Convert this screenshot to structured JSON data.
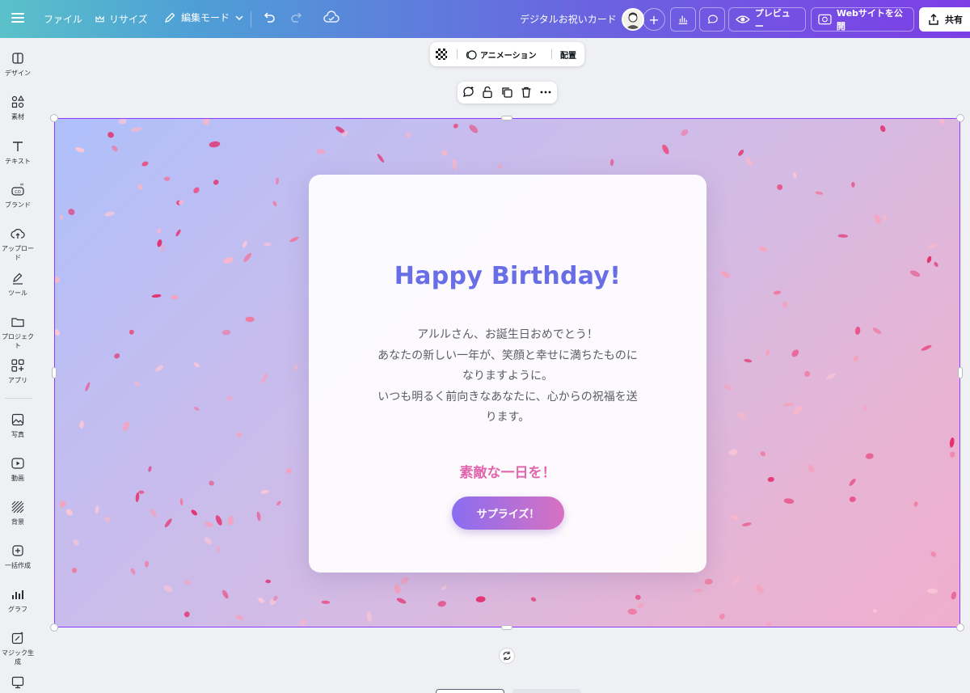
{
  "topbar": {
    "file": "ファイル",
    "resize": "リサイズ",
    "edit_mode": "編集モード",
    "title": "デジタルお祝いカード",
    "preview": "プレビュー",
    "publish": "Webサイトを公開",
    "share": "共有"
  },
  "sidebar": {
    "items": [
      {
        "label": "デザイン",
        "icon": "design-icon"
      },
      {
        "label": "素材",
        "icon": "elements-icon"
      },
      {
        "label": "テキスト",
        "icon": "text-icon"
      },
      {
        "label": "ブランド",
        "icon": "brand-icon"
      },
      {
        "label": "アップロード",
        "icon": "upload-icon"
      },
      {
        "label": "ツール",
        "icon": "tools-icon"
      },
      {
        "label": "プロジェクト",
        "icon": "folder-icon"
      },
      {
        "label": "アプリ",
        "icon": "apps-icon"
      },
      {
        "label": "写真",
        "icon": "photo-icon"
      },
      {
        "label": "動画",
        "icon": "video-icon"
      },
      {
        "label": "背景",
        "icon": "background-icon"
      },
      {
        "label": "一括作成",
        "icon": "bulk-create-icon"
      },
      {
        "label": "グラフ",
        "icon": "chart-icon"
      },
      {
        "label": "マジック生成",
        "icon": "magic-icon"
      }
    ]
  },
  "context_toolbar": {
    "animation": "アニメーション",
    "arrange": "配置"
  },
  "card": {
    "heading": "Happy Birthday!",
    "message_lines": [
      "アルルさん、お誕生日おめでとう！",
      "あなたの新しい一年が、笑顔と幸せに満ちたものに",
      "なりますように。",
      "いつも明るく前向きなあなたに、心からの祝福を送",
      "ります。"
    ],
    "closing": "素敵な一日を！",
    "button": "サプライズ！"
  },
  "colors": {
    "accent": "#8b3dff",
    "heading": "#6a6ee6",
    "closing": "#e266ad"
  }
}
